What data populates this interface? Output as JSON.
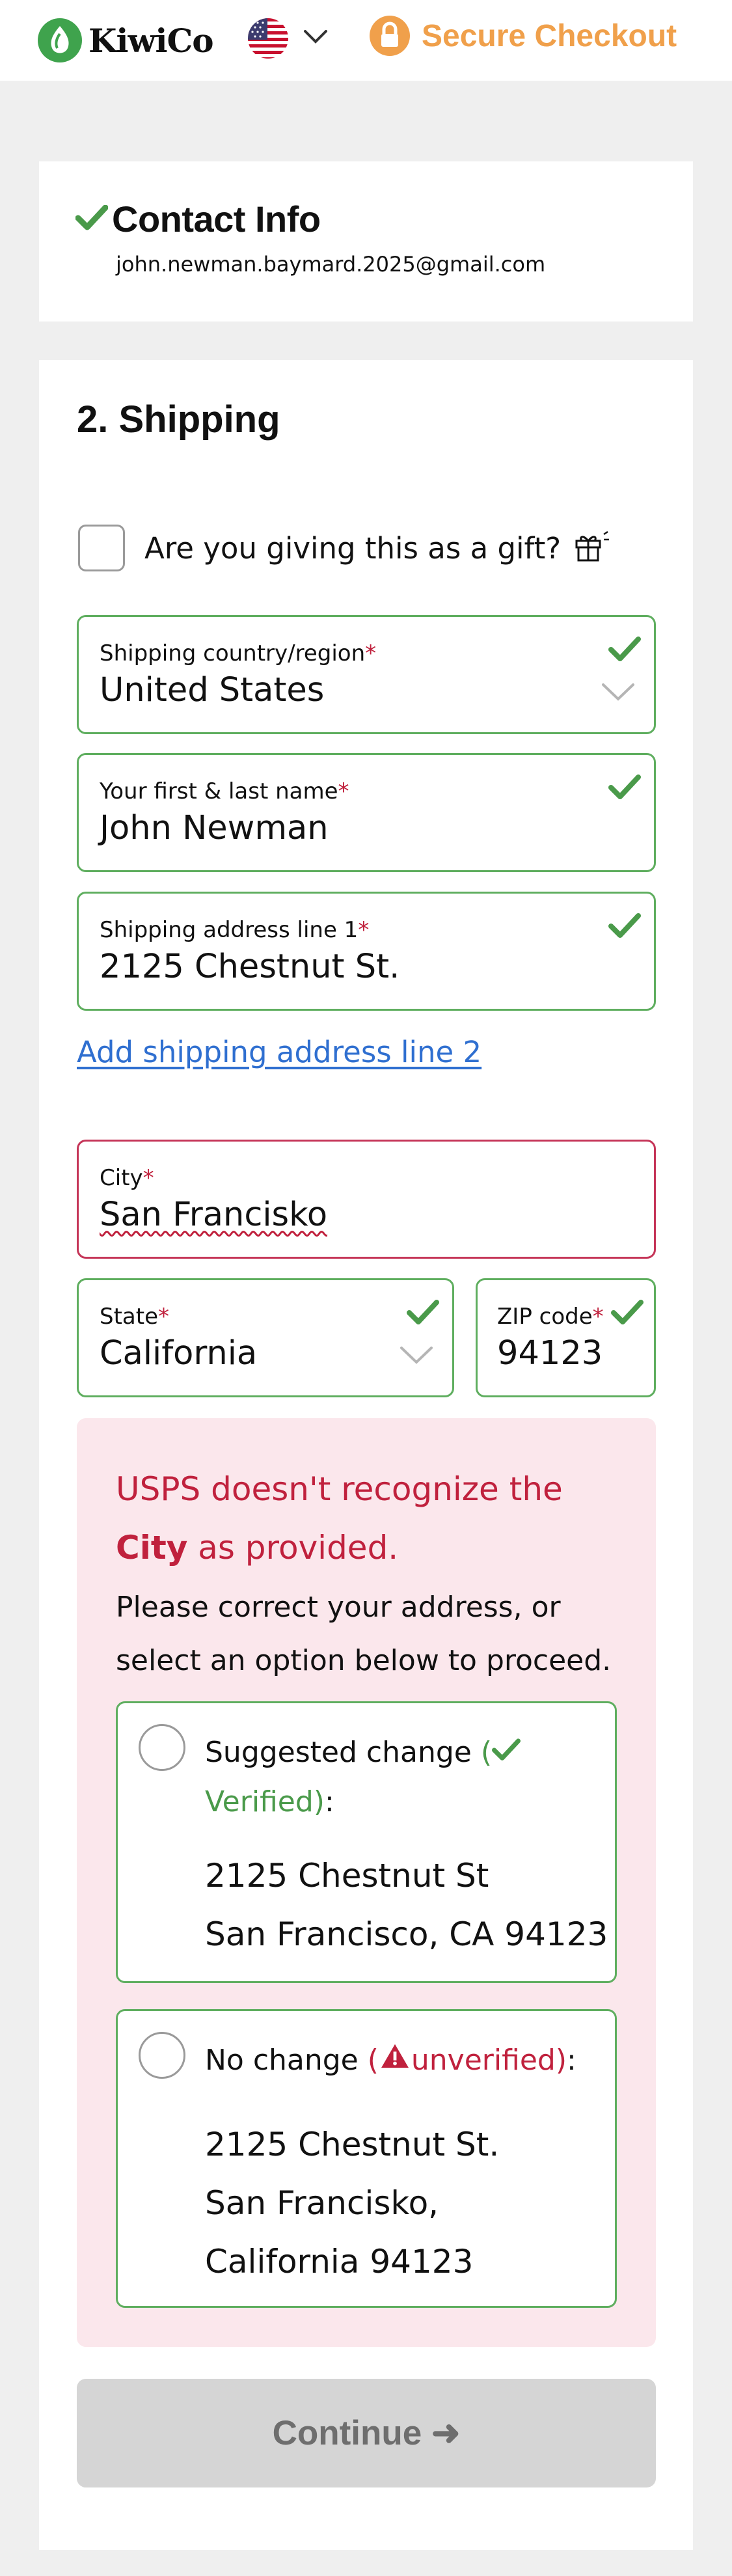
{
  "header": {
    "brand": "KiwiCo",
    "country_flag_icon": "us-flag-icon",
    "secure_checkout": "Secure Checkout",
    "colors": {
      "brand_green": "#3fa34d",
      "secure_orange": "#f0a04b"
    }
  },
  "contact": {
    "title": "Contact Info",
    "email": "john.newman.baymard.2025@gmail.com",
    "status_icon": "check-icon"
  },
  "shipping": {
    "title": "2. Shipping",
    "gift_label": "Are you giving this as a gift?",
    "gift_icon": "gift-icon",
    "fields": {
      "country": {
        "label": "Shipping country/region",
        "required": "*",
        "value": "United States"
      },
      "name": {
        "label": "Your first & last name",
        "required": "*",
        "value": "John Newman"
      },
      "address1": {
        "label": "Shipping address line 1",
        "required": "*",
        "value": "2125 Chestnut St."
      },
      "city": {
        "label": "City",
        "required": "*",
        "value": "San Francisko"
      },
      "state": {
        "label": "State",
        "required": "*",
        "value": "California"
      },
      "zip": {
        "label": "ZIP code",
        "required": "*",
        "value": "94123"
      }
    },
    "add_line2": "Add shipping address line 2",
    "validation": {
      "heading_part1": "USPS doesn't recognize the",
      "heading_bold": "City",
      "heading_part2": " as provided.",
      "body": "Please correct your address, or select an option below to proceed.",
      "suggested": {
        "label": "Suggested change",
        "open_paren": " (",
        "status": "Verified",
        "close": "):",
        "line1": "2125 Chestnut St",
        "line2": "San Francisco, CA 94123"
      },
      "nochange": {
        "label": "No change",
        "open_paren": " (",
        "status": "unverified",
        "close": "):",
        "line1": "2125 Chestnut St.",
        "line2": "San Francisko,",
        "line3": "California 94123"
      }
    },
    "continue_label": "Continue ➜"
  }
}
